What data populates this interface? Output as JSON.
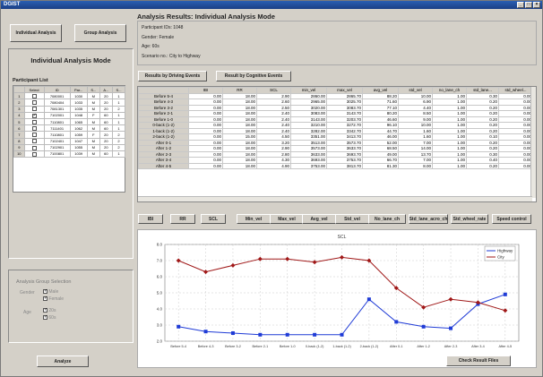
{
  "app": {
    "title": "DGIST",
    "min": "_",
    "max": "□",
    "close": "×"
  },
  "mode_buttons": {
    "individual": "Individual Analysis",
    "group": "Group Analysis"
  },
  "left": {
    "mode_title": "Individual Analysis Mode",
    "plist_title": "Participant List",
    "plist_cols": [
      "Select",
      "ID",
      "Par...",
      "S...",
      "A...",
      "S..."
    ],
    "plist_rows": [
      {
        "n": "1",
        "sel": false,
        "id": "7080001",
        "par": "1030",
        "s": "M",
        "a": "20",
        "x": "1"
      },
      {
        "n": "2",
        "sel": false,
        "id": "7080404",
        "par": "1033",
        "s": "M",
        "a": "20",
        "x": "1"
      },
      {
        "n": "3",
        "sel": false,
        "id": "7081301",
        "par": "1035",
        "s": "M",
        "a": "20",
        "x": "2"
      },
      {
        "n": "4",
        "sel": true,
        "id": "7102001",
        "par": "1048",
        "s": "F",
        "a": "60",
        "x": "1"
      },
      {
        "n": "5",
        "sel": false,
        "id": "7110801",
        "par": "1065",
        "s": "M",
        "a": "60",
        "x": "1"
      },
      {
        "n": "6",
        "sel": false,
        "id": "7111401",
        "par": "1062",
        "s": "M",
        "a": "60",
        "x": "1"
      },
      {
        "n": "7",
        "sel": false,
        "id": "7110801",
        "par": "1059",
        "s": "F",
        "a": "20",
        "x": "2"
      },
      {
        "n": "8",
        "sel": false,
        "id": "7102401",
        "par": "1047",
        "s": "M",
        "a": "20",
        "x": "2"
      },
      {
        "n": "9",
        "sel": false,
        "id": "7102901",
        "par": "1055",
        "s": "M",
        "a": "20",
        "x": "2"
      },
      {
        "n": "10",
        "sel": false,
        "id": "7100801",
        "par": "1039",
        "s": "M",
        "a": "60",
        "x": "1"
      }
    ],
    "group_title": "Analysis Group Selection",
    "gender_label": "Gender",
    "gender_opts": [
      {
        "label": "Male",
        "on": true
      },
      {
        "label": "Female",
        "on": true
      }
    ],
    "age_label": "Age",
    "age_opts": [
      {
        "label": "20s",
        "on": true
      },
      {
        "label": "60s",
        "on": true
      }
    ],
    "analyze": "Analyze"
  },
  "results": {
    "title": "Analysis Results: Individual Analysis Mode",
    "info": [
      "Participant IDs: 1048",
      "Gender: Female",
      "Age: 60s",
      "Scenario no.: City to Highway"
    ],
    "tab_driving": "Results by Driving Events",
    "tab_cognitive": "Result by Cognitive Events",
    "columns": [
      "",
      "IBI",
      "RR",
      "SCL",
      "min_vel",
      "max_vel",
      "avg_vel",
      "std_vel",
      "no_lane_ch",
      "std_lane...",
      "std_wheel..."
    ],
    "rows": [
      [
        "Before 5-4",
        "0.00",
        "18.00",
        "2.90",
        "2860.00",
        "2865.70",
        "88.20",
        "10.00",
        "1.00",
        "0.30",
        "0.00"
      ],
      [
        "Before 4-3",
        "0.00",
        "18.00",
        "2.60",
        "2965.00",
        "3025.70",
        "71.60",
        "6.90",
        "1.00",
        "0.20",
        "0.00"
      ],
      [
        "Before 3-2",
        "0.00",
        "18.00",
        "2.50",
        "3020.00",
        "3083.70",
        "77.10",
        "4.40",
        "1.00",
        "0.20",
        "0.00"
      ],
      [
        "Before 2-1",
        "0.00",
        "18.00",
        "2.40",
        "3083.00",
        "3143.70",
        "80.20",
        "8.50",
        "1.00",
        "0.20",
        "0.00"
      ],
      [
        "Before 1-0",
        "0.00",
        "18.00",
        "2.40",
        "3143.00",
        "3203.70",
        "46.60",
        "9.00",
        "1.00",
        "0.20",
        "0.00"
      ],
      [
        "0-back (1-2)",
        "0.00",
        "18.00",
        "2.40",
        "3210.00",
        "3272.70",
        "96.10",
        "10.00",
        "1.00",
        "0.20",
        "0.00"
      ],
      [
        "1-back (1-2)",
        "0.00",
        "18.00",
        "2.40",
        "3282.00",
        "3342.70",
        "44.70",
        "1.60",
        "1.00",
        "0.20",
        "0.00"
      ],
      [
        "2-back (1-2)",
        "0.00",
        "15.00",
        "4.50",
        "3351.00",
        "3413.70",
        "46.00",
        "1.60",
        "1.00",
        "0.10",
        "0.00"
      ],
      [
        "After 0-1",
        "0.00",
        "18.00",
        "3.20",
        "3513.00",
        "3573.70",
        "52.00",
        "7.00",
        "1.00",
        "0.20",
        "0.00"
      ],
      [
        "After 1-2",
        "0.00",
        "18.00",
        "2.90",
        "3573.00",
        "3633.70",
        "68.50",
        "14.00",
        "1.00",
        "0.20",
        "0.00"
      ],
      [
        "After 2-3",
        "0.00",
        "18.00",
        "2.80",
        "3633.00",
        "3693.70",
        "49.00",
        "13.70",
        "1.00",
        "0.30",
        "0.00"
      ],
      [
        "After 3-4",
        "0.00",
        "18.00",
        "4.30",
        "3693.00",
        "3753.70",
        "66.70",
        "7.00",
        "1.00",
        "0.40",
        "0.00"
      ],
      [
        "After 4-5",
        "0.00",
        "18.00",
        "4.90",
        "3753.00",
        "3813.70",
        "81.30",
        "8.00",
        "1.00",
        "0.20",
        "0.00"
      ]
    ],
    "metric_buttons": [
      "IBI",
      "RR",
      "SCL",
      "Min_vel",
      "Max_vel",
      "Avg_vel",
      "Std_vel",
      "No_lane_ch",
      "Std_lane_acro_ch",
      "Std_wheel_rate",
      "Speed control"
    ],
    "check_files": "Check Result Files"
  },
  "chart_data": {
    "type": "line",
    "title": "SCL",
    "categories": [
      "Before 5-4",
      "Before 4-3",
      "Before 3-2",
      "Before 2-1",
      "Before 1-0",
      "0-back (1-2)",
      "1-back (1-2)",
      "2-back (1-2)",
      "After 0-1",
      "After 1-2",
      "After 2-3",
      "After 3-4",
      "After 4-5"
    ],
    "ylim": [
      2.0,
      8.0
    ],
    "yticks": [
      "8.0",
      "7.0",
      "6.0",
      "5.0",
      "4.0",
      "3.0",
      "2.0"
    ],
    "series": [
      {
        "name": "Highway",
        "color": "#1f3bd6",
        "marker": "square",
        "values": [
          2.9,
          2.6,
          2.5,
          2.4,
          2.4,
          2.4,
          2.4,
          4.6,
          3.2,
          2.9,
          2.8,
          4.3,
          4.9
        ]
      },
      {
        "name": "City",
        "color": "#a01818",
        "marker": "diamond",
        "values": [
          7.0,
          6.3,
          6.7,
          7.1,
          7.1,
          6.9,
          7.2,
          7.0,
          5.3,
          4.1,
          4.6,
          4.4,
          3.9
        ]
      }
    ]
  }
}
